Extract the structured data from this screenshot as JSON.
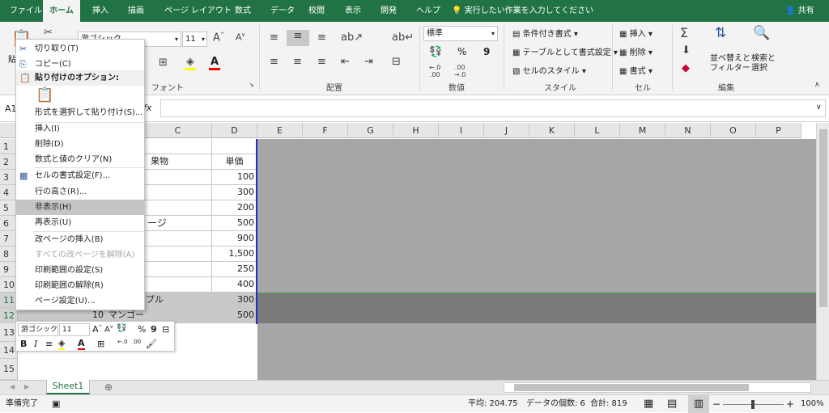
{
  "ribbon_tabs": [
    "ファイル",
    "ホーム",
    "挿入",
    "描画",
    "ページ レイアウト",
    "数式",
    "データ",
    "校閲",
    "表示",
    "開発",
    "ヘルプ"
  ],
  "tell_me": "実行したい作業を入力してください",
  "share": "共有",
  "ribbon": {
    "clipboard_paste": "貼",
    "font_name": "游ゴシック",
    "font_size": "11",
    "group_font": "フォント",
    "group_align": "配置",
    "number_format": "標準",
    "group_number": "数値",
    "cond_format": "条件付き書式",
    "table_format": "テーブルとして書式設定",
    "cell_styles": "セルのスタイル",
    "group_styles": "スタイル",
    "insert": "挿入",
    "delete": "削除",
    "format": "書式",
    "group_cells": "セル",
    "sort_filter_1": "並べ替えと",
    "sort_filter_2": "フィルター",
    "find_select_1": "検索と",
    "find_select_2": "選択",
    "group_edit": "編集",
    "percent": "%",
    "comma": "9"
  },
  "formula_bar": {
    "namebox": "A1",
    "fx": "fx",
    "value": ""
  },
  "columns": [
    "C",
    "D",
    "E",
    "F",
    "G",
    "H",
    "I",
    "J",
    "K",
    "L",
    "M",
    "N",
    "O",
    "P"
  ],
  "rows": [
    "1",
    "2",
    "3",
    "4",
    "5",
    "6",
    "7",
    "8",
    "9",
    "10",
    "11",
    "12",
    "13",
    "14",
    "15"
  ],
  "cells": {
    "c2": "果物",
    "d2": "単価",
    "d3": "100",
    "d4": "300",
    "d5": "200",
    "d6": "500",
    "d7": "900",
    "d8": "1,500",
    "d9": "250",
    "d10": "400",
    "c6": "ージ",
    "c11": "プル",
    "d11": "300",
    "b12": "10",
    "c12": "マンゴー",
    "d12": "500"
  },
  "context_menu": [
    {
      "label": "切り取り(T)",
      "icon": "✂",
      "disabled": false
    },
    {
      "label": "コピー(C)",
      "icon": "⎘",
      "disabled": false
    },
    {
      "label": "貼り付けのオプション:",
      "icon": "📋",
      "disabled": false,
      "bold": true
    },
    {
      "label": "形式を選択して貼り付け(S)...",
      "icon": "",
      "disabled": false
    },
    {
      "label": "挿入(I)",
      "icon": "",
      "disabled": false
    },
    {
      "label": "削除(D)",
      "icon": "",
      "disabled": false
    },
    {
      "label": "数式と値のクリア(N)",
      "icon": "",
      "disabled": false
    },
    {
      "label": "セルの書式設定(F)...",
      "icon": "▦",
      "disabled": false
    },
    {
      "label": "行の高さ(R)...",
      "icon": "",
      "disabled": false
    },
    {
      "label": "非表示(H)",
      "icon": "",
      "disabled": false,
      "highlight": true
    },
    {
      "label": "再表示(U)",
      "icon": "",
      "disabled": false
    },
    {
      "label": "改ページの挿入(B)",
      "icon": "",
      "disabled": false
    },
    {
      "label": "すべての改ページを解除(A)",
      "icon": "",
      "disabled": true
    },
    {
      "label": "印刷範囲の設定(S)",
      "icon": "",
      "disabled": false
    },
    {
      "label": "印刷範囲の解除(R)",
      "icon": "",
      "disabled": false
    },
    {
      "label": "ページ設定(U)...",
      "icon": "",
      "disabled": false
    }
  ],
  "mini_toolbar": {
    "font": "游ゴシック",
    "size": "11",
    "percent": "%",
    "comma": "9",
    "bold": "B",
    "italic": "I"
  },
  "sheet_tab": "Sheet1",
  "status": {
    "ready": "準備完了",
    "average": "平均: 204.75",
    "count": "データの個数: 6",
    "sum": "合計: 819",
    "zoom": "100%"
  },
  "colors": {
    "accent": "#217346",
    "grid_gray": "#a6a6a6",
    "selection_border": "#2828c8"
  }
}
